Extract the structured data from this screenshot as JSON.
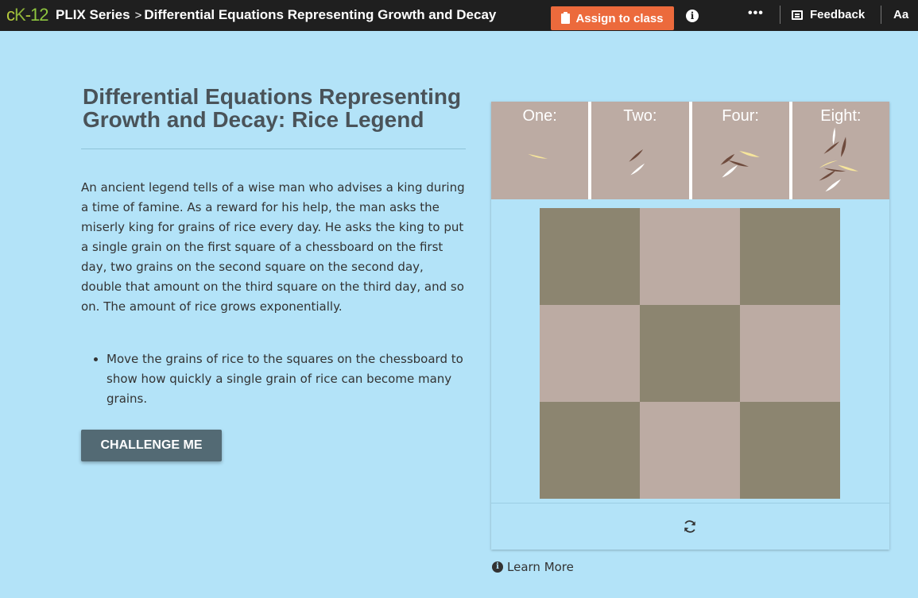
{
  "topbar": {
    "logo": "cK-12",
    "series": "PLIX Series",
    "separator": ">",
    "page_title": "Differential Equations Representing Growth and Decay",
    "assign_label": "Assign to class",
    "info_glyph": "i",
    "more_glyph": "•••",
    "feedback_label": "Feedback",
    "text_size_label": "Aa"
  },
  "main": {
    "title": "Differential Equations Representing Growth and Decay: Rice Legend",
    "intro": "An ancient legend tells of a wise man who advises a king during a time of famine. As a reward for his help, the man asks the miserly king for grains of rice every day.  He asks the king to put a single grain on the first square of a chessboard on the first day, two grains on the second square on the second day, double that amount on the third square on the third day, and so on. The amount of rice grows exponentially.",
    "bullets": [
      "Move the grains of rice to the squares on the chessboard to show how quickly a single grain of rice can become many grains."
    ],
    "challenge_label": "CHALLENGE ME"
  },
  "simulation": {
    "legend": [
      {
        "label": "One:",
        "grains": 1
      },
      {
        "label": "Two:",
        "grains": 2
      },
      {
        "label": "Four:",
        "grains": 4
      },
      {
        "label": "Eight:",
        "grains": 8
      }
    ],
    "board": {
      "rows": 3,
      "cols": 3
    },
    "colors": {
      "dark_square": "#8c8570",
      "light_square": "#bcaba3",
      "grain_yellow": "#f6e59b",
      "grain_brown": "#6e4a3c",
      "grain_white": "#ffffff"
    },
    "reset_icon": "refresh-icon"
  },
  "learn_more_label": "Learn More",
  "accent": {
    "assign": "#ec6a3c",
    "challenge": "#536a74",
    "background": "#b3e3f8"
  }
}
